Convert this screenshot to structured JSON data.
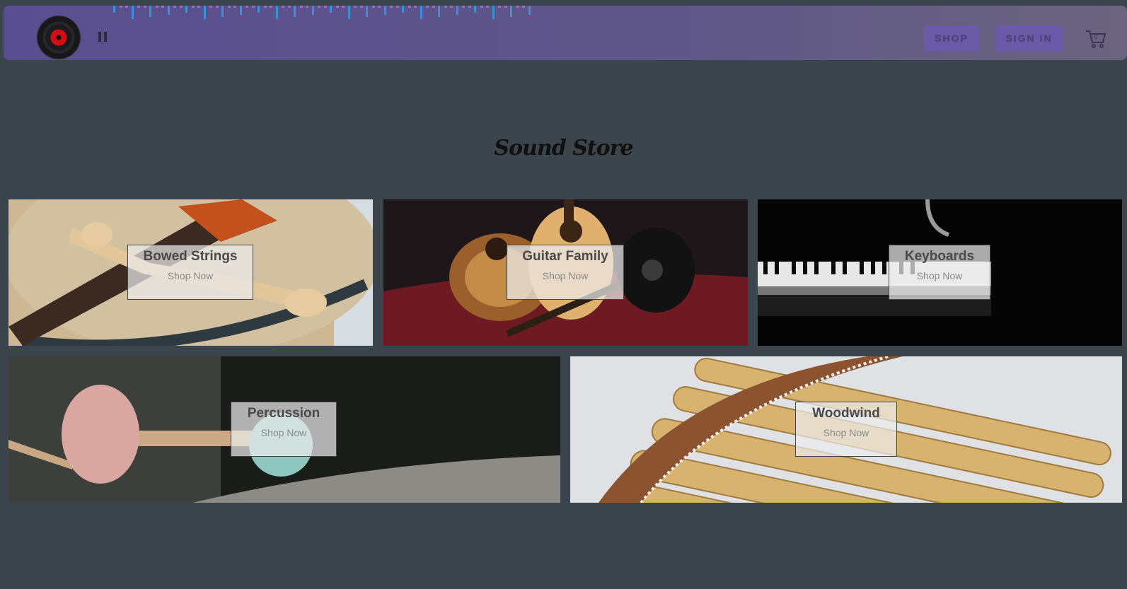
{
  "header": {
    "shop_label": "SHOP",
    "signin_label": "SIGN IN",
    "cart_count": "0",
    "player_state": "playing"
  },
  "page": {
    "title": "Sound Store"
  },
  "categories": [
    {
      "name": "Bowed Strings",
      "cta": "Shop Now"
    },
    {
      "name": "Guitar Family",
      "cta": "Shop Now"
    },
    {
      "name": "Keyboards",
      "cta": "Shop Now"
    },
    {
      "name": "Percussion",
      "cta": "Shop Now"
    },
    {
      "name": "Woodwind",
      "cta": "Shop Now"
    }
  ],
  "icons": {
    "record": "vinyl-record-icon",
    "pause": "pause-icon",
    "cart": "shopping-cart-icon"
  },
  "colors": {
    "page_background": "#3c444c",
    "header_start": "#594e90",
    "header_end": "#6a647e",
    "button_background": "#6a59a6",
    "visualizer_bar": "#3f8fd6",
    "record_label": "#d10f14"
  }
}
